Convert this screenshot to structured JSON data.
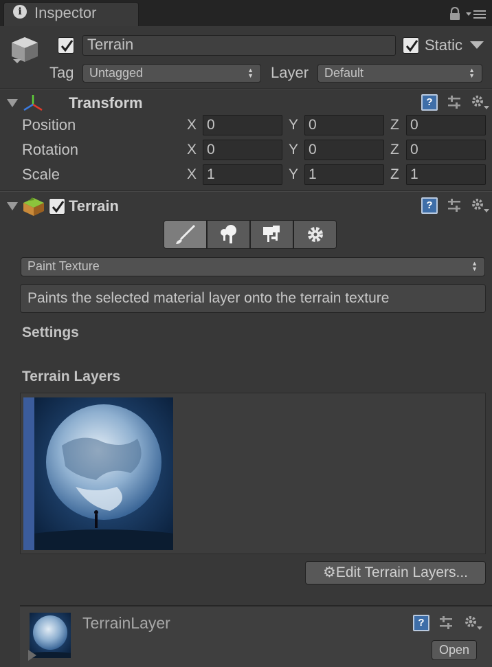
{
  "tab": {
    "label": "Inspector",
    "info_icon": "i"
  },
  "header": {
    "object_name": "Terrain",
    "static_label": "Static",
    "tag_label": "Tag",
    "tag_value": "Untagged",
    "layer_label": "Layer",
    "layer_value": "Default",
    "active": true,
    "static": true
  },
  "transform": {
    "title": "Transform",
    "rows": [
      {
        "label": "Position",
        "x": "0",
        "y": "0",
        "z": "0"
      },
      {
        "label": "Rotation",
        "x": "0",
        "y": "0",
        "z": "0"
      },
      {
        "label": "Scale",
        "x": "1",
        "y": "1",
        "z": "1"
      }
    ],
    "axis_x": "X",
    "axis_y": "Y",
    "axis_z": "Z"
  },
  "terrain": {
    "title": "Terrain",
    "enabled": true,
    "tools": [
      {
        "name": "paint-brush",
        "active": true
      },
      {
        "name": "paint-trees",
        "active": false
      },
      {
        "name": "paint-details",
        "active": false
      },
      {
        "name": "settings",
        "active": false
      }
    ],
    "mode_value": "Paint Texture",
    "mode_description": "Paints the selected material layer onto the terrain texture",
    "settings_label": "Settings",
    "layers_label": "Terrain Layers",
    "edit_button": "Edit Terrain Layers...",
    "selection_color": "#3b5c9c"
  },
  "terrain_layer": {
    "title": "TerrainLayer",
    "open_button": "Open"
  },
  "icons": {
    "help": "?",
    "accent_help": "#3e6ea8"
  }
}
